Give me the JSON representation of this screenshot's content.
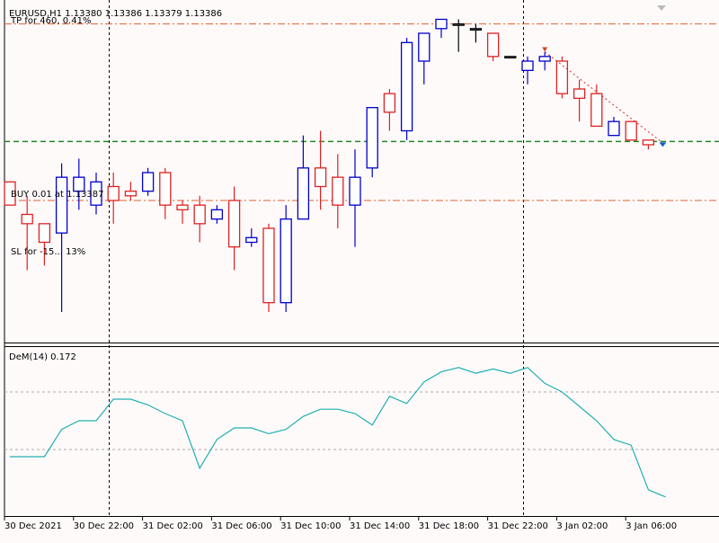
{
  "header": {
    "symbol_info": "EURUSD,H1  1.13380 1.13386 1.13379 1.13386"
  },
  "trade_levels": {
    "tp_label": "TP for 460, 0.41%",
    "buy_label": "BUY 0.01 at 1.13387",
    "sl_label": "SL for -15... 13%"
  },
  "indicator": {
    "label": "DeM(14) 0.172"
  },
  "time_labels": [
    "30 Dec 2021",
    "30 Dec 22:00",
    "31 Dec 02:00",
    "31 Dec 06:00",
    "31 Dec 10:00",
    "31 Dec 14:00",
    "31 Dec 18:00",
    "31 Dec 22:00",
    "3 Jan 02:00",
    "3 Jan 06:00"
  ],
  "colors": {
    "bull": "#0000cc",
    "bear": "#dd2222",
    "tp_sl_line": "#e06030",
    "buy_line": "#228822",
    "demarker": "#20b0b0"
  },
  "chart_data": [
    {
      "type": "candlestick",
      "symbol": "EURUSD",
      "timeframe": "H1",
      "title": "EURUSD,H1",
      "price_range": [
        1.1296,
        1.1368
      ],
      "levels": {
        "tp": 1.1364,
        "buy": 1.13387,
        "sl": 1.1326
      },
      "candles": [
        {
          "o": 1.133,
          "h": 1.133,
          "l": 1.1325,
          "c": 1.1325
        },
        {
          "o": 1.1323,
          "h": 1.1327,
          "l": 1.1311,
          "c": 1.1321
        },
        {
          "o": 1.1321,
          "h": 1.1321,
          "l": 1.1312,
          "c": 1.1317
        },
        {
          "o": 1.1319,
          "h": 1.1334,
          "l": 1.1302,
          "c": 1.1331
        },
        {
          "o": 1.1328,
          "h": 1.1335,
          "l": 1.1324,
          "c": 1.1331
        },
        {
          "o": 1.1325,
          "h": 1.1332,
          "l": 1.1323,
          "c": 1.133
        },
        {
          "o": 1.1329,
          "h": 1.1332,
          "l": 1.1321,
          "c": 1.1326
        },
        {
          "o": 1.1328,
          "h": 1.133,
          "l": 1.1326,
          "c": 1.1327
        },
        {
          "o": 1.1328,
          "h": 1.1333,
          "l": 1.1327,
          "c": 1.1332
        },
        {
          "o": 1.1332,
          "h": 1.1333,
          "l": 1.1322,
          "c": 1.1325
        },
        {
          "o": 1.1325,
          "h": 1.1326,
          "l": 1.1321,
          "c": 1.1324
        },
        {
          "o": 1.1325,
          "h": 1.1327,
          "l": 1.1317,
          "c": 1.1321
        },
        {
          "o": 1.1322,
          "h": 1.1325,
          "l": 1.1321,
          "c": 1.1324
        },
        {
          "o": 1.1326,
          "h": 1.1329,
          "l": 1.1311,
          "c": 1.1316
        },
        {
          "o": 1.1317,
          "h": 1.132,
          "l": 1.1316,
          "c": 1.1318
        },
        {
          "o": 1.132,
          "h": 1.1321,
          "l": 1.1302,
          "c": 1.1304
        },
        {
          "o": 1.1304,
          "h": 1.1325,
          "l": 1.1302,
          "c": 1.1322
        },
        {
          "o": 1.1322,
          "h": 1.134,
          "l": 1.1322,
          "c": 1.1333
        },
        {
          "o": 1.1333,
          "h": 1.1341,
          "l": 1.1324,
          "c": 1.1329
        },
        {
          "o": 1.1331,
          "h": 1.1336,
          "l": 1.132,
          "c": 1.1325
        },
        {
          "o": 1.1325,
          "h": 1.1337,
          "l": 1.1316,
          "c": 1.1331
        },
        {
          "o": 1.1333,
          "h": 1.1346,
          "l": 1.1331,
          "c": 1.1346
        },
        {
          "o": 1.1349,
          "h": 1.135,
          "l": 1.1341,
          "c": 1.1345
        },
        {
          "o": 1.1341,
          "h": 1.1361,
          "l": 1.1339,
          "c": 1.136
        },
        {
          "o": 1.1356,
          "h": 1.1362,
          "l": 1.1351,
          "c": 1.1362
        },
        {
          "o": 1.1363,
          "h": 1.1365,
          "l": 1.1361,
          "c": 1.1365
        },
        {
          "o": 1.1364,
          "h": 1.1365,
          "l": 1.1358,
          "c": 1.1364
        },
        {
          "o": 1.1363,
          "h": 1.1364,
          "l": 1.136,
          "c": 1.1363
        },
        {
          "o": 1.1362,
          "h": 1.1362,
          "l": 1.1356,
          "c": 1.1357
        },
        {
          "o": 1.1357,
          "h": 1.1357,
          "l": 1.1357,
          "c": 1.1357
        },
        {
          "o": 1.1354,
          "h": 1.1357,
          "l": 1.1351,
          "c": 1.1356
        },
        {
          "o": 1.1356,
          "h": 1.1358,
          "l": 1.1354,
          "c": 1.1357
        },
        {
          "o": 1.1356,
          "h": 1.1357,
          "l": 1.1348,
          "c": 1.1349
        },
        {
          "o": 1.135,
          "h": 1.1352,
          "l": 1.1343,
          "c": 1.1348
        },
        {
          "o": 1.1349,
          "h": 1.1351,
          "l": 1.1342,
          "c": 1.1342
        },
        {
          "o": 1.134,
          "h": 1.1344,
          "l": 1.134,
          "c": 1.1343
        },
        {
          "o": 1.1343,
          "h": 1.1343,
          "l": 1.1339,
          "c": 1.1339
        },
        {
          "o": 1.1339,
          "h": 1.1339,
          "l": 1.1337,
          "c": 1.1338
        }
      ]
    },
    {
      "type": "line",
      "title": "DeM(14) 0.172",
      "series": [
        {
          "name": "DeM(14)",
          "values": [
            0.25,
            0.25,
            0.25,
            0.44,
            0.5,
            0.5,
            0.65,
            0.65,
            0.61,
            0.55,
            0.5,
            0.17,
            0.37,
            0.45,
            0.45,
            0.41,
            0.44,
            0.53,
            0.58,
            0.58,
            0.55,
            0.47,
            0.67,
            0.62,
            0.77,
            0.84,
            0.87,
            0.83,
            0.86,
            0.83,
            0.87,
            0.76,
            0.7,
            0.6,
            0.5,
            0.37,
            0.33,
            0.02,
            -0.03
          ]
        }
      ],
      "ylim": [
        -0.15,
        1.0
      ],
      "levels": [
        0.3,
        0.7
      ]
    }
  ]
}
